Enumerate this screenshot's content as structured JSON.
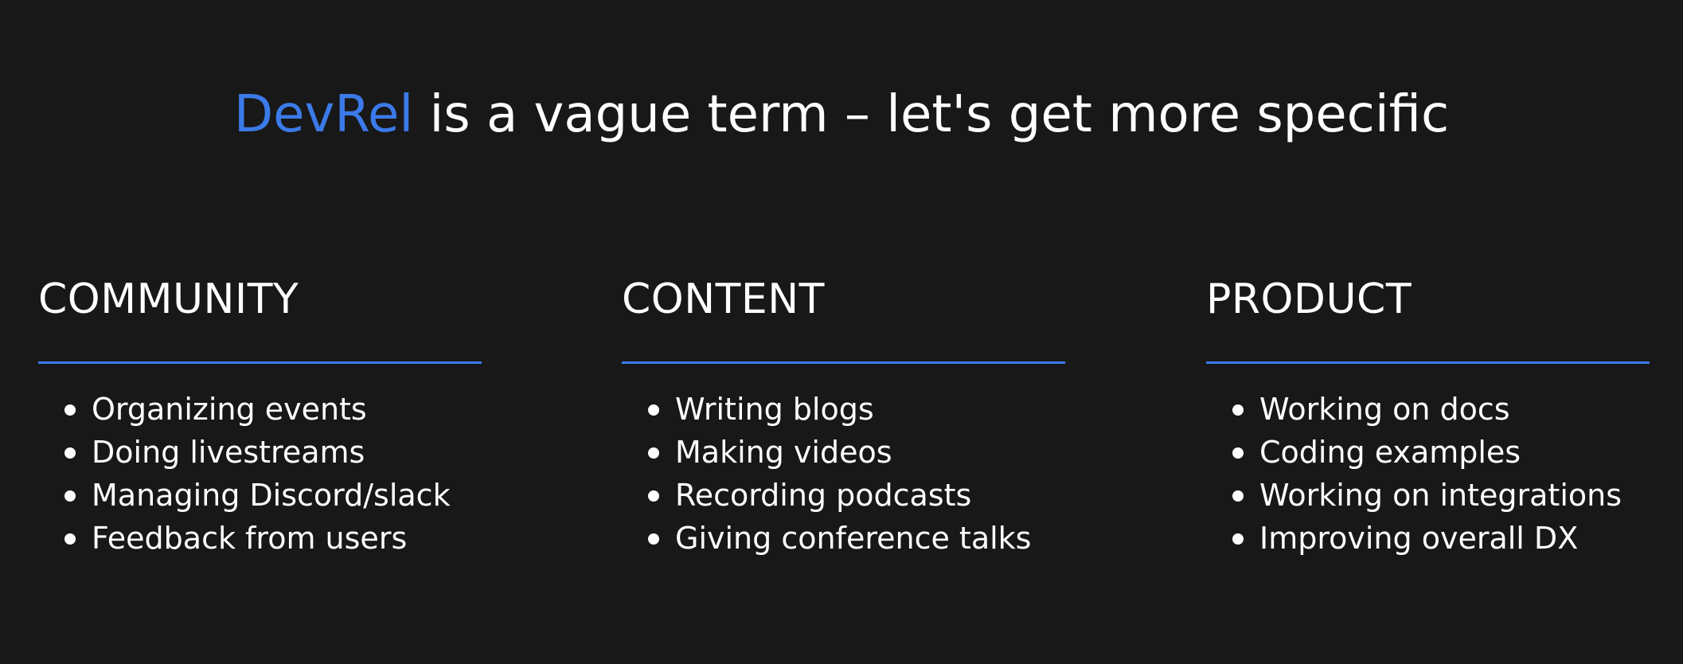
{
  "title": {
    "accent": "DevRel",
    "rest": " is a vague term – let's get more specific",
    "accent_color": "#3b7ae8"
  },
  "columns": [
    {
      "heading": "COMMUNITY",
      "items": [
        "Organizing events",
        "Doing livestreams",
        "Managing Discord/slack",
        "Feedback from users"
      ]
    },
    {
      "heading": "CONTENT",
      "items": [
        "Writing blogs",
        "Making videos",
        "Recording podcasts",
        "Giving conference talks"
      ]
    },
    {
      "heading": "PRODUCT",
      "items": [
        "Working on docs",
        "Coding examples",
        "Working on integrations",
        "Improving overall DX"
      ]
    }
  ],
  "colors": {
    "background": "#181818",
    "text": "#ffffff",
    "accent": "#3b7ae8"
  }
}
